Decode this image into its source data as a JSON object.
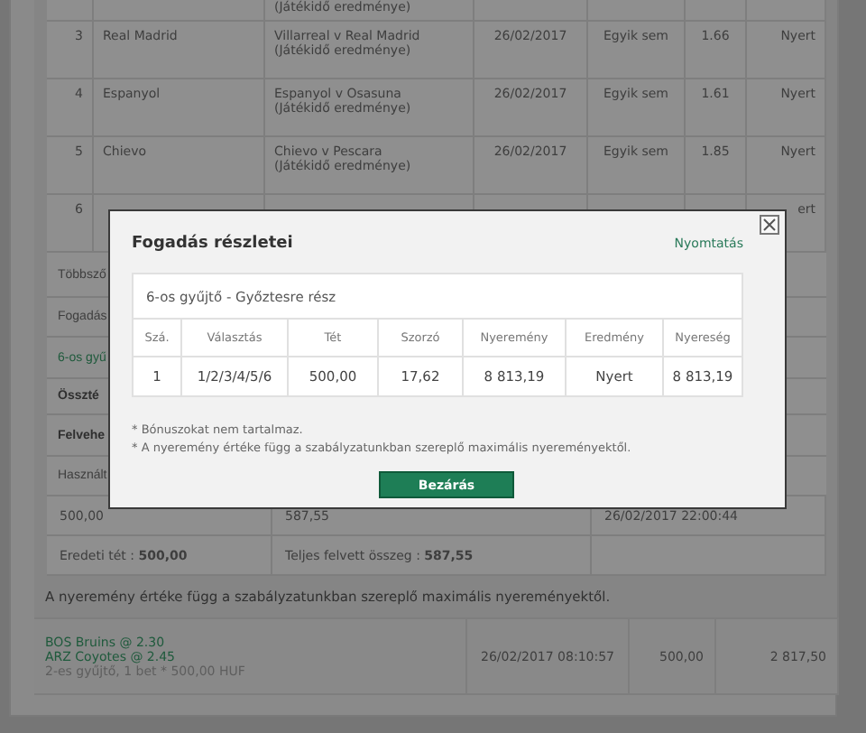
{
  "bets_table": {
    "rows": [
      {
        "event_note": "(Játékidő eredménye)"
      },
      {
        "number": "3",
        "selection": "Real Madrid",
        "event": "Villarreal v Real Madrid",
        "event_note": "(Játékidő eredménye)",
        "date": "26/02/2017",
        "handicap": "Egyik sem",
        "odds": "1.66",
        "result": "Nyert"
      },
      {
        "number": "4",
        "selection": "Espanyol",
        "event": "Espanyol v Osasuna",
        "event_note": "(Játékidő eredménye)",
        "date": "26/02/2017",
        "handicap": "Egyik sem",
        "odds": "1.61",
        "result": "Nyert"
      },
      {
        "number": "5",
        "selection": "Chievo",
        "event": "Chievo v Pescara",
        "event_note": "(Játékidő eredménye)",
        "date": "26/02/2017",
        "handicap": "Egyik sem",
        "odds": "1.85",
        "result": "Nyert"
      },
      {
        "number": "6",
        "result": "ert"
      }
    ]
  },
  "summary_rows": [
    {
      "label": "Többsző",
      "kind": "plain"
    },
    {
      "label": "Fogadás",
      "kind": "plain"
    },
    {
      "label": "6-os gyű",
      "kind": "green"
    },
    {
      "label": "Összté",
      "kind": "bold"
    },
    {
      "label": "Felvehe",
      "kind": "bold"
    },
    {
      "label": "Használt",
      "kind": "plain"
    }
  ],
  "values_row": [
    "500,00",
    "587,55",
    "26/02/2017 22:00:44"
  ],
  "totals_row": [
    "Eredeti tét : **500,00**",
    "Teljes felvett összeg : **587,55**"
  ],
  "note": "A nyeremény értéke függ a szabályzatunkban szereplő maximális nyereményektől.",
  "bet_list": [
    {
      "selections": [
        "BOS Bruins @ 2.30",
        "ARZ Coyotes @ 2.45"
      ],
      "description": "2-es gyűjtő, 1 bet * 500,00 HUF",
      "date": "26/02/2017 08:10:57",
      "stake": "500,00",
      "return": "2 817,50"
    }
  ],
  "dialog": {
    "title": "Fogadás részletei",
    "print_link": "Nyomtatás",
    "subtitle": "6-os gyűjtő - Győztesre rész",
    "columns": [
      "Szá.",
      "Választás",
      "Tét",
      "Szorzó",
      "Nyeremény",
      "Eredmény",
      "Nyereség"
    ],
    "rows": [
      [
        "1",
        "1/2/3/4/5/6",
        "500,00",
        "17,62",
        "8 813,19",
        "Nyert",
        "8 813,19"
      ]
    ],
    "notes": [
      "* Bónuszokat nem tartalmaz.",
      "* A nyeremény értéke függ a szabályzatunkban szereplő maximális nyereményektől."
    ],
    "button": "Bezárás"
  }
}
